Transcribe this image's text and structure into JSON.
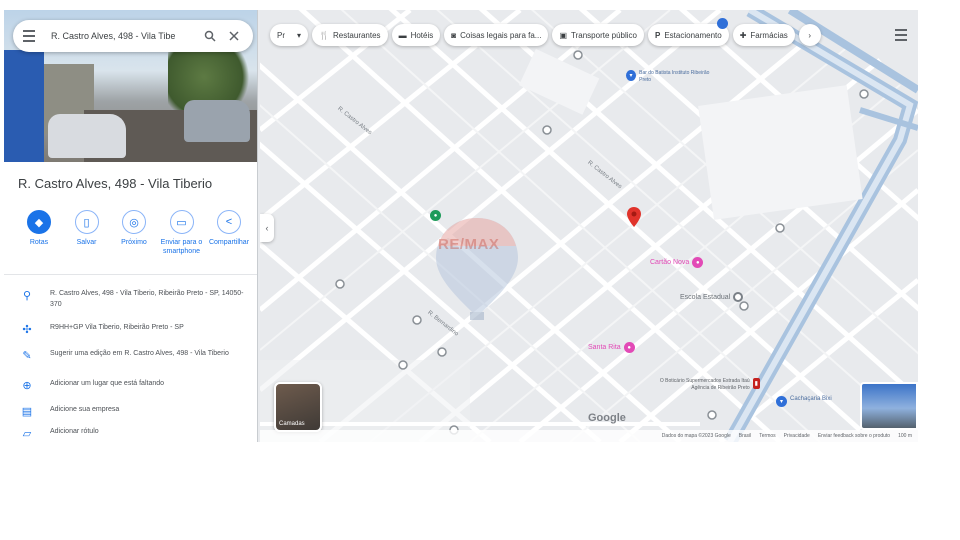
{
  "search": {
    "query": "R. Castro Alves, 498 - Vila Tibe"
  },
  "place": {
    "title": "R. Castro Alves, 498 - Vila Tiberio",
    "actions": [
      {
        "label": "Rotas",
        "icon": "directions-icon"
      },
      {
        "label": "Salvar",
        "icon": "bookmark-icon"
      },
      {
        "label": "Próximo",
        "icon": "nearby-icon"
      },
      {
        "label": "Enviar para o smartphone",
        "icon": "phone-icon"
      },
      {
        "label": "Compartilhar",
        "icon": "share-icon"
      }
    ],
    "info": [
      {
        "icon": "location-pin-icon",
        "text": "R. Castro Alves, 498 - Vila Tiberio, Ribeirão Preto - SP, 14050-370"
      },
      {
        "icon": "plus-code-icon",
        "text": "R9HH+GP Vila Tiberio, Ribeirão Preto - SP"
      },
      {
        "icon": "edit-icon",
        "text": "Sugerir uma edição em R. Castro Alves, 498 - Vila Tiberio"
      },
      {
        "icon": "add-place-icon",
        "text": "Adicionar um lugar que está faltando"
      },
      {
        "icon": "business-icon",
        "text": "Adicione sua empresa"
      },
      {
        "icon": "label-icon",
        "text": "Adicionar rótulo"
      }
    ]
  },
  "map": {
    "chips": [
      {
        "label": "Restaurantes",
        "icon": "restaurant-icon"
      },
      {
        "label": "Hotéis",
        "icon": "hotel-icon"
      },
      {
        "label": "Coisas legais para fa...",
        "icon": "camera-icon"
      },
      {
        "label": "Transporte público",
        "icon": "transit-icon"
      },
      {
        "label": "Estacionamento",
        "icon": "parking-icon"
      },
      {
        "label": "Farmácias",
        "icon": "pharmacy-icon"
      }
    ],
    "pois": [
      {
        "name": "Cartão Nova",
        "style": "pink"
      },
      {
        "name": "Santa Rita",
        "style": "pink"
      },
      {
        "name": "Escola Estadual",
        "style": "grey"
      },
      {
        "name": "Bar do Batista Instituto Ribeirão Preto",
        "style": "blue"
      },
      {
        "name": "O Boticário Supermercados Estrada Itaú Agência de Ribeirão Preto",
        "style": "red"
      },
      {
        "name": "Cachaçaria Bixi",
        "style": "blue"
      }
    ],
    "watermark_text": "RE/MAX",
    "layers_label": "Camadas",
    "google_logo": "Google",
    "footer": [
      "Dados do mapa ©2023 Google",
      "Brasil",
      "Termos",
      "Privacidade",
      "Enviar feedback sobre o produto",
      "100 m"
    ]
  }
}
